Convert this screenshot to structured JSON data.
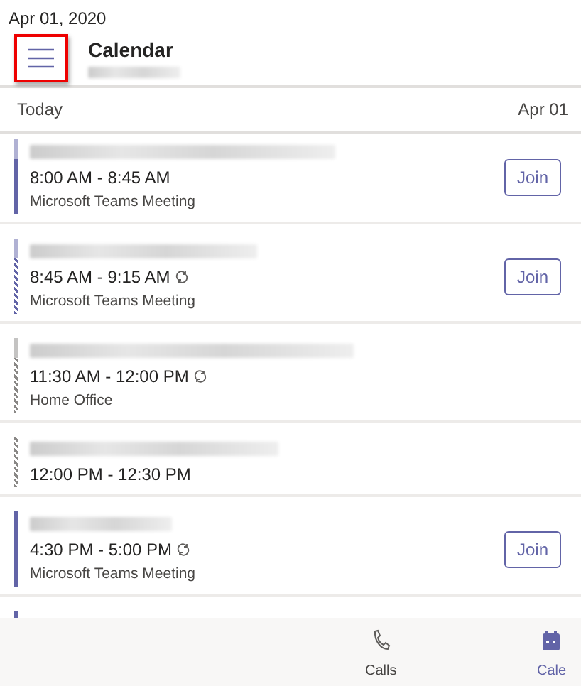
{
  "status_date": "Apr 01, 2020",
  "header": {
    "title": "Calendar",
    "subtitle_blurred": true,
    "menu_highlighted": true
  },
  "day": {
    "label": "Today",
    "date": "Apr 01"
  },
  "events": [
    {
      "title_blurred": true,
      "time": "8:00 AM - 8:45 AM",
      "recurring": false,
      "location": "Microsoft Teams Meeting",
      "join": "Join",
      "color": "#6264a7",
      "hatched": false,
      "faded_top": true
    },
    {
      "title_blurred": true,
      "time": "8:45 AM - 9:15 AM",
      "recurring": true,
      "location": "Microsoft Teams Meeting",
      "join": "Join",
      "color": "#6264a7",
      "hatched": true,
      "faded_top": true
    },
    {
      "title_blurred": true,
      "time": "11:30 AM - 12:00 PM",
      "recurring": true,
      "location": "Home Office",
      "color": "#8a8886",
      "hatched": true,
      "faded_top": true
    },
    {
      "title_blurred": true,
      "time": "12:00 PM - 12:30 PM",
      "recurring": false,
      "color": "#8a8886",
      "hatched": true,
      "faded_top": false
    },
    {
      "title_blurred": true,
      "time": "4:30 PM - 5:00 PM",
      "recurring": true,
      "location": "Microsoft Teams Meeting",
      "join": "Join",
      "color": "#6264a7",
      "hatched": false,
      "faded_top": false
    }
  ],
  "bottom_nav": [
    {
      "label": "Calls",
      "kind": "phone",
      "selected": false
    },
    {
      "label": "Cale",
      "kind": "calendar",
      "selected": true
    }
  ]
}
